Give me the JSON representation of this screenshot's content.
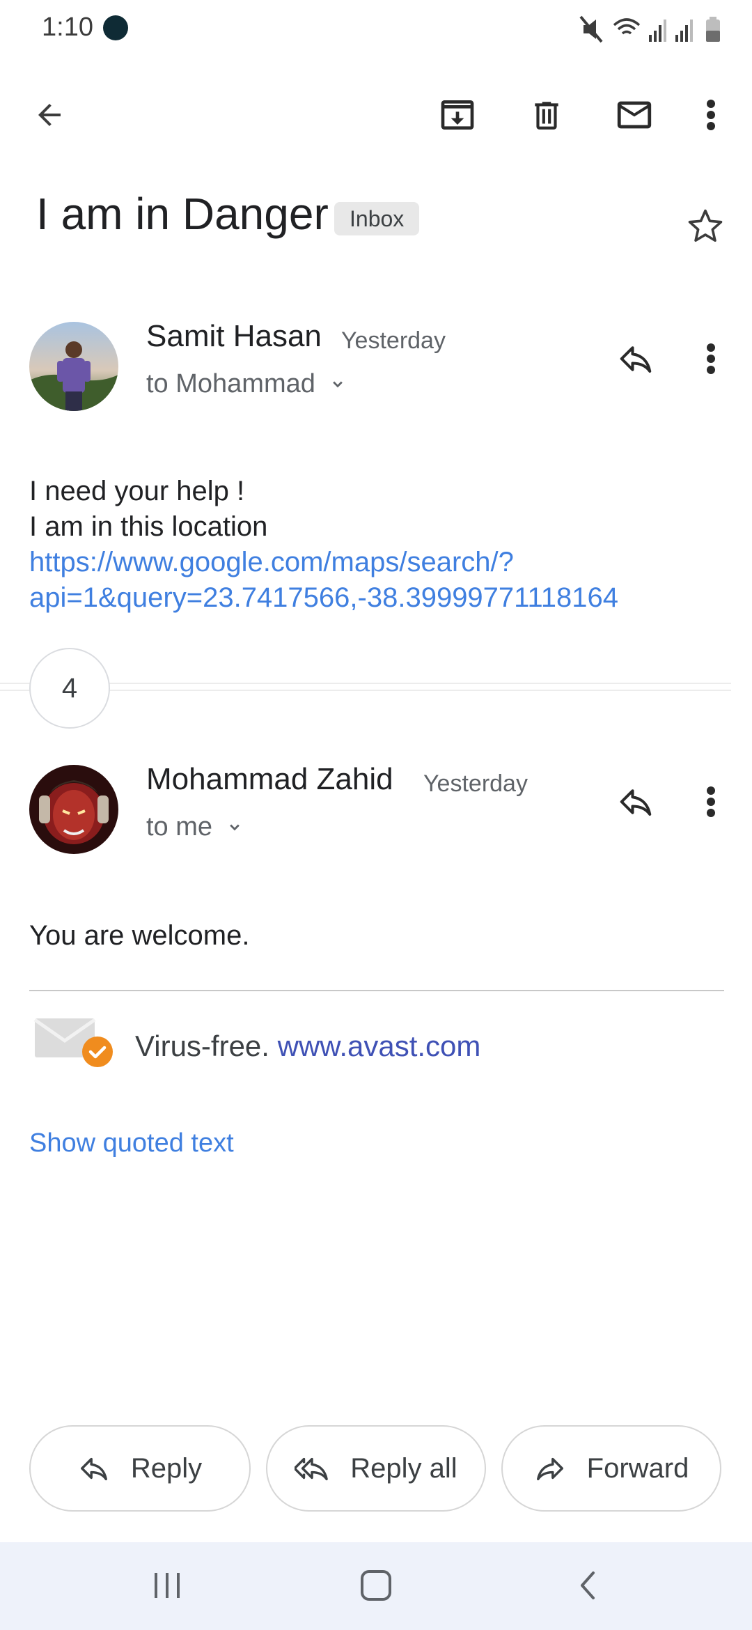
{
  "status_bar": {
    "time": "1:10"
  },
  "toolbar": {
    "icons": [
      "back-arrow-icon",
      "archive-icon",
      "trash-icon",
      "mail-icon",
      "more-vert-icon"
    ]
  },
  "thread": {
    "subject": "I am in Danger",
    "label": "Inbox",
    "collapsed_count": "4"
  },
  "message1": {
    "sender": "Samit Hasan",
    "date": "Yesterday",
    "recipient": "to Mohammad",
    "body_lines": [
      "I need your help !",
      "I am in this location"
    ],
    "link_line1": "https://www.google.com/maps/search/?",
    "link_line2": "api=1&query=23.7417566,-38.39999771118164"
  },
  "message2": {
    "sender": "Mohammad Zahid",
    "date": "Yesterday",
    "recipient": "to me",
    "body": "You are welcome.",
    "virus_text": "Virus-free.",
    "virus_link": "www.avast.com",
    "show_quoted": "Show quoted text"
  },
  "actions": {
    "reply": "Reply",
    "reply_all": "Reply all",
    "forward": "Forward"
  },
  "colors": {
    "link": "#3f7fe0",
    "avast_link": "#3f51b5",
    "nav_bg": "#eef2fa",
    "badge_orange": "#f08c1e"
  }
}
